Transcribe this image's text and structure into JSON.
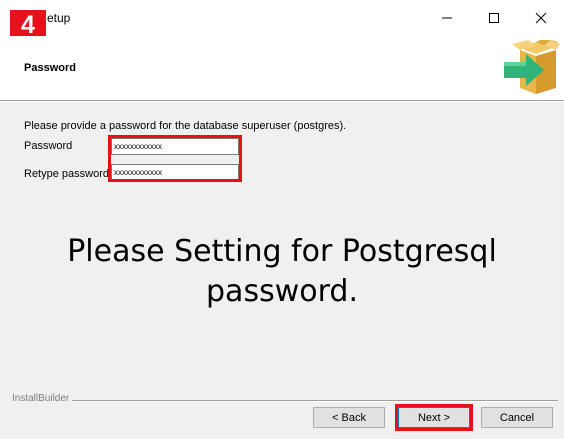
{
  "step_badge": "4",
  "window": {
    "title": "etup",
    "minimize": "—",
    "maximize": "☐",
    "close": "✕"
  },
  "header": {
    "title": "Password",
    "icon": "install-box-arrow-icon"
  },
  "content": {
    "description": "Please provide a password for the database superuser (postgres).",
    "password_label": "Password",
    "password_value": "xxxxxxxxxxxx",
    "retype_label": "Retype password",
    "retype_value": "xxxxxxxxxxxx"
  },
  "annotation": {
    "line1": "Please Setting for Postgresql",
    "line2": "password."
  },
  "footer": {
    "brand": "InstallBuilder",
    "back_label": "< Back",
    "next_label": "Next >",
    "cancel_label": "Cancel"
  },
  "colors": {
    "highlight": "#e8101a",
    "box": "#e8b64a",
    "arrow": "#2fb47a"
  }
}
